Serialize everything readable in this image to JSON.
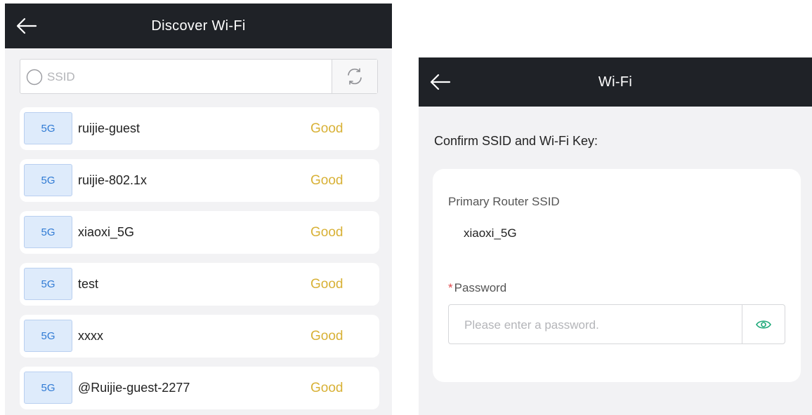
{
  "colors": {
    "header_bg": "#1f2227",
    "signal_good": "#d8b136",
    "band_badge_text": "#2f7ad4",
    "required": "#e0484b",
    "eye_icon": "#1aa877"
  },
  "discover": {
    "title": "Discover Wi-Fi",
    "back_icon": "arrow-left-icon",
    "search": {
      "placeholder": "SSID",
      "value": "",
      "icon": "search-icon"
    },
    "refresh_icon": "refresh-icon",
    "networks": [
      {
        "band": "5G",
        "ssid": "ruijie-guest",
        "signal": "Good"
      },
      {
        "band": "5G",
        "ssid": "ruijie-802.1x",
        "signal": "Good"
      },
      {
        "band": "5G",
        "ssid": "xiaoxi_5G",
        "signal": "Good"
      },
      {
        "band": "5G",
        "ssid": "test",
        "signal": "Good"
      },
      {
        "band": "5G",
        "ssid": "xxxx",
        "signal": "Good"
      },
      {
        "band": "5G",
        "ssid": "@Ruijie-guest-2277",
        "signal": "Good"
      }
    ]
  },
  "wifi": {
    "title": "Wi-Fi",
    "back_icon": "arrow-left-icon",
    "section_title": "Confirm SSID and Wi-Fi Key:",
    "ssid_label": "Primary Router SSID",
    "ssid_value": "xiaoxi_5G",
    "password_required_mark": "*",
    "password_label": "Password",
    "password_placeholder": "Please enter a password.",
    "password_value": "",
    "eye_icon": "eye-icon"
  }
}
